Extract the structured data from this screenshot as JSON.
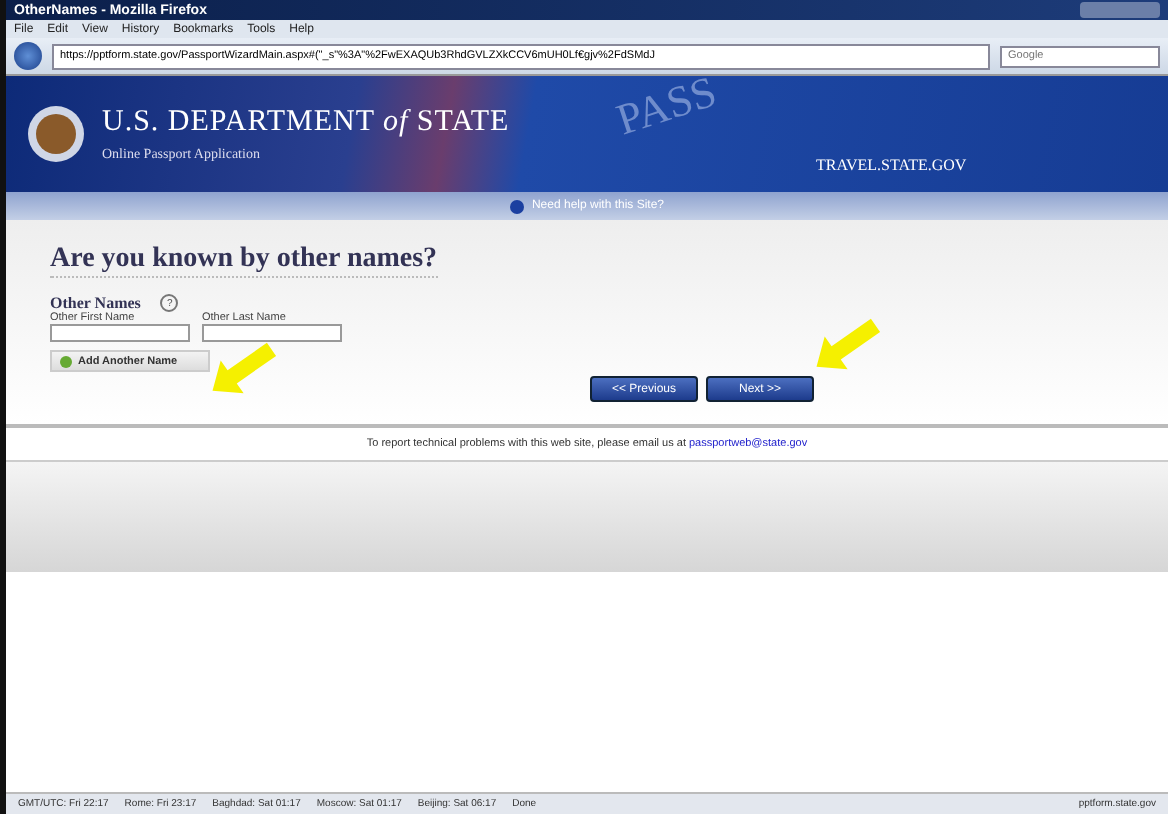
{
  "window": {
    "title": "OtherNames - Mozilla Firefox"
  },
  "menu": [
    "File",
    "Edit",
    "View",
    "History",
    "Bookmarks",
    "Tools",
    "Help"
  ],
  "address": "https://pptform.state.gov/PassportWizardMain.aspx#(\"_s\"%3A\"%2FwEXAQUb3RhdGVLZXkCCV6mUH0Lf€gjv%2FdSMdJ",
  "search": {
    "placeholder": "Google"
  },
  "banner": {
    "title_main": "U.S. DEPARTMENT",
    "title_of": "of",
    "title_end": "STATE",
    "subtitle": "Online Passport Application",
    "watermark": "PASS",
    "site": "TRAVEL.STATE.GOV"
  },
  "help_link": "Need help with this Site?",
  "heading": "Are you known by other names?",
  "section": "Other Names",
  "help_mark": "?",
  "fields": [
    {
      "label": "Other First Name"
    },
    {
      "label": "Other Last Name"
    }
  ],
  "add_button": "Add Another Name",
  "nav_buttons": [
    "<< Previous",
    "Next >>"
  ],
  "footer": {
    "text": "To report technical problems with this web site, please email us at ",
    "link": "passportweb@state.gov"
  },
  "status": [
    "GMT/UTC: Fri 22:17",
    "Rome: Fri 23:17",
    "Baghdad: Sat 01:17",
    "Moscow: Sat 01:17",
    "Beijing: Sat 06:17",
    "Done"
  ],
  "status_host": "pptform.state.gov"
}
